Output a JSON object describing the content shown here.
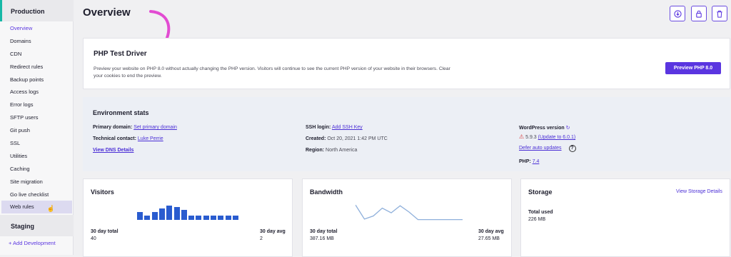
{
  "sidebar": {
    "production_label": "Production",
    "items": [
      {
        "label": "Overview"
      },
      {
        "label": "Domains"
      },
      {
        "label": "CDN"
      },
      {
        "label": "Redirect rules"
      },
      {
        "label": "Backup points"
      },
      {
        "label": "Access logs"
      },
      {
        "label": "Error logs"
      },
      {
        "label": "SFTP users"
      },
      {
        "label": "Git push"
      },
      {
        "label": "SSL"
      },
      {
        "label": "Utilities"
      },
      {
        "label": "Caching"
      },
      {
        "label": "Site migration"
      },
      {
        "label": "Go live checklist"
      },
      {
        "label": "Web rules"
      }
    ],
    "staging_label": "Staging",
    "add_dev_label": "+ Add Development"
  },
  "header": {
    "title": "Overview",
    "buttons": [
      "download-icon",
      "lock-icon",
      "trash-icon"
    ]
  },
  "php_driver": {
    "title": "PHP Test Driver",
    "description": "Preview your website on PHP 8.0 without actually changing the PHP version. Visitors will continue to see the current PHP version of your website in their browsers. Clear your cookies to end the preview.",
    "button_label": "Preview PHP 8.0"
  },
  "env_stats": {
    "title": "Environment stats",
    "primary_domain_label": "Primary domain:",
    "primary_domain_link": "Set primary domain",
    "technical_contact_label": "Technical contact:",
    "technical_contact_link": "Luke Perrie",
    "dns_link": "View DNS Details",
    "ssh_label": "SSH login:",
    "ssh_link": "Add SSH Key",
    "created_label": "Created:",
    "created_value": "Oct 20, 2021 1:42 PM UTC",
    "region_label": "Region:",
    "region_value": "North America",
    "wp_label": "WordPress version",
    "wp_version": "5.9.3",
    "wp_update_link": "(Update to 6.0.1)",
    "defer_link": "Defer auto updates",
    "php_label": "PHP:",
    "php_link": "7.4"
  },
  "visitors": {
    "title": "Visitors",
    "total_label": "30 day total",
    "total_value": "40",
    "avg_label": "30 day avg",
    "avg_value": "2",
    "bars": [
      1,
      0.55,
      1,
      1.4,
      1.75,
      1.6,
      1.2,
      0.55,
      0.55,
      0.55,
      0.55,
      0.55,
      0.55,
      0.55
    ],
    "color": "#2a5ccf"
  },
  "bandwidth": {
    "title": "Bandwidth",
    "total_label": "30 day total",
    "total_value": "387.16 MB",
    "avg_label": "30 day avg",
    "avg_value": "27.65 MB",
    "line": [
      0.95,
      0.05,
      0.25,
      0.75,
      0.45,
      0.9,
      0.5,
      0.02,
      0.02,
      0.02,
      0.02,
      0.02,
      0.02
    ],
    "color": "#8fb0db"
  },
  "storage": {
    "title": "Storage",
    "details_link": "View Storage Details",
    "used_label": "Total used",
    "used_value": "226 MB"
  },
  "accent": "#5a35e0"
}
